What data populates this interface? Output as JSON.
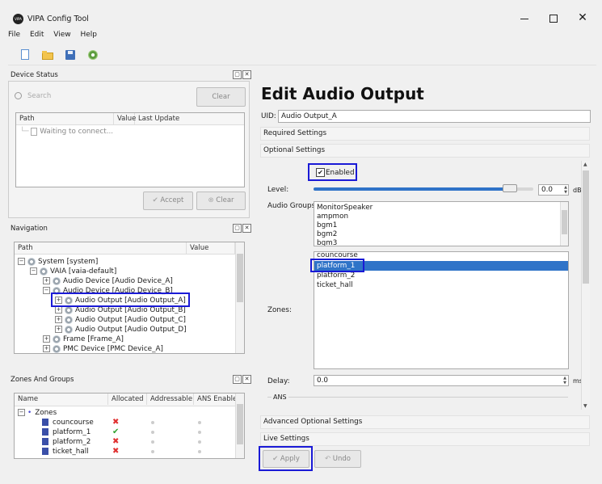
{
  "window": {
    "title": "VIPA Config Tool",
    "logo_text": "VIPA"
  },
  "menu": [
    "File",
    "Edit",
    "View",
    "Help"
  ],
  "toolbar": {
    "icons": [
      "new-icon",
      "open-folder-icon",
      "save-icon",
      "settings-gear-icon"
    ]
  },
  "device_status": {
    "title": "Device Status",
    "search_placeholder": "Search",
    "clear_label": "Clear",
    "columns": [
      "Path",
      "Value",
      "Last Update"
    ],
    "row_text": "Waiting to connect...",
    "accept_label": "Accept",
    "clear2_label": "Clear"
  },
  "navigation": {
    "title": "Navigation",
    "columns": [
      "Path",
      "Value"
    ],
    "rows": [
      "System [system]",
      "VAIA [vaia-default]",
      "Audio Device [Audio Device_A]",
      "Audio Device [Audio Device_B]",
      "Audio Output [Audio Output_A]",
      "Audio Output [Audio Output_B]",
      "Audio Output [Audio Output_C]",
      "Audio Output [Audio Output_D]",
      "Frame [Frame_A]",
      "PMC Device [PMC Device_A]"
    ]
  },
  "zones_groups": {
    "title": "Zones And Groups",
    "columns": [
      "Name",
      "Allocated",
      "Addressable",
      "ANS Enabled"
    ],
    "group_label": "Zones",
    "rows": [
      {
        "name": "councourse",
        "allocated": "✖"
      },
      {
        "name": "platform_1",
        "allocated": "✔"
      },
      {
        "name": "platform_2",
        "allocated": "✖"
      },
      {
        "name": "ticket_hall",
        "allocated": "✖"
      }
    ]
  },
  "editor": {
    "heading": "Edit Audio Output",
    "uid_label": "UID:",
    "uid_value": "Audio Output_A",
    "required_settings": "Required Settings",
    "optional_settings": "Optional Settings",
    "enabled_label": "Enabled",
    "level_label": "Level:",
    "level_value": "0.0",
    "level_unit": "dB",
    "level_fraction": 0.92,
    "audio_groups_label": "Audio Groups:",
    "audio_groups": [
      "MonitorSpeaker",
      "ampmon",
      "bgm1",
      "bgm2",
      "bgm3"
    ],
    "zones_label": "Zones:",
    "zones": [
      "councourse",
      "platform_1",
      "platform_2",
      "ticket_hall"
    ],
    "zones_selected": "platform_1",
    "delay_label": "Delay:",
    "delay_value": "0.0",
    "delay_unit": "ms",
    "ans_label": "ANS",
    "advanced_settings": "Advanced Optional Settings",
    "live_settings": "Live Settings",
    "apply_label": "Apply",
    "undo_label": "Undo"
  }
}
